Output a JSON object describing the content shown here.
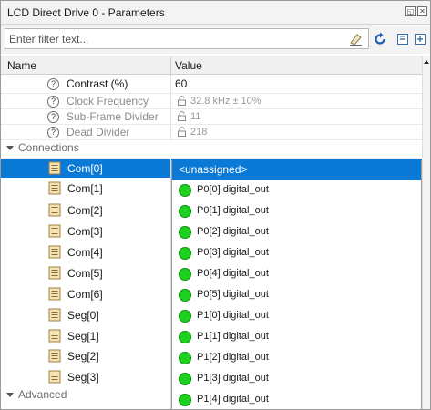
{
  "window": {
    "title": "LCD Direct Drive 0 - Parameters",
    "restore_glyph": "◱",
    "close_glyph": "✕"
  },
  "toolbar": {
    "filter_placeholder": "Enter filter text...",
    "icons": [
      "eraser-icon",
      "refresh-icon",
      "collapse-all-icon",
      "expand-all-icon"
    ]
  },
  "grid": {
    "columns": [
      "Name",
      "Value"
    ],
    "parameters": [
      {
        "name": "Contrast (%)",
        "value": "60",
        "readonly": false
      },
      {
        "name": "Clock Frequency",
        "value": "32.8 kHz ± 10%",
        "readonly": true
      },
      {
        "name": "Sub-Frame Divider",
        "value": "11",
        "readonly": true
      },
      {
        "name": "Dead Divider",
        "value": "218",
        "readonly": true
      }
    ],
    "categories": {
      "connections": "Connections",
      "advanced": "Advanced"
    },
    "connections": [
      {
        "name": "Com[0]",
        "selected": true
      },
      {
        "name": "Com[1]"
      },
      {
        "name": "Com[2]"
      },
      {
        "name": "Com[3]"
      },
      {
        "name": "Com[4]"
      },
      {
        "name": "Com[5]"
      },
      {
        "name": "Com[6]"
      },
      {
        "name": "Seg[0]"
      },
      {
        "name": "Seg[1]"
      },
      {
        "name": "Seg[2]"
      },
      {
        "name": "Seg[3]"
      }
    ]
  },
  "dropdown": {
    "selected": "<unassigned>",
    "options": [
      "P0[0] digital_out",
      "P0[1] digital_out",
      "P0[2] digital_out",
      "P0[3] digital_out",
      "P0[4] digital_out",
      "P0[5] digital_out",
      "P1[0] digital_out",
      "P1[1] digital_out",
      "P1[2] digital_out",
      "P1[3] digital_out",
      "P1[4] digital_out"
    ]
  },
  "colors": {
    "selection": "#0a7ad6",
    "pin_dot": "#1fd11f"
  }
}
